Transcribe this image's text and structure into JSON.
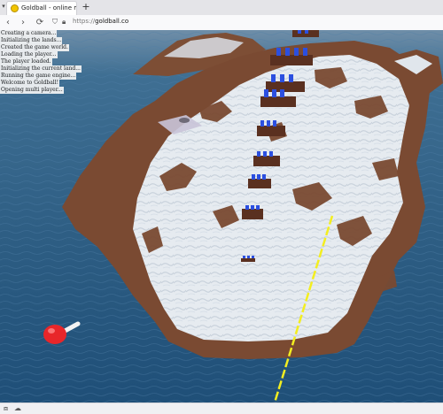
{
  "browser": {
    "tab_title": "Goldball - online multiplay",
    "new_tab": "+",
    "tab_list": "▾",
    "back": "‹",
    "forward": "›",
    "reload": "⟳",
    "url_prefix": "https://",
    "url_domain": "goldball.co",
    "icons": [
      "shield-icon",
      "lock-icon"
    ]
  },
  "game": {
    "log": [
      "Creating a camera...",
      "Initializing the lands...",
      "Created the game world.",
      "Loading the player...",
      "The player loaded.",
      "Initializing the current land...",
      "Running the game engine...",
      "Welcome to Goldball!",
      "Opening multi player..."
    ]
  },
  "status": {
    "icons": [
      "screenshot-icon",
      "cloud-icon"
    ]
  },
  "colors": {
    "water": "#2f5f86",
    "snow": "#e9edf1",
    "rock": "#7a4a32",
    "player": "#e8262a",
    "blocks": "#2b4fe0",
    "aim_line": "#f3ee20"
  }
}
